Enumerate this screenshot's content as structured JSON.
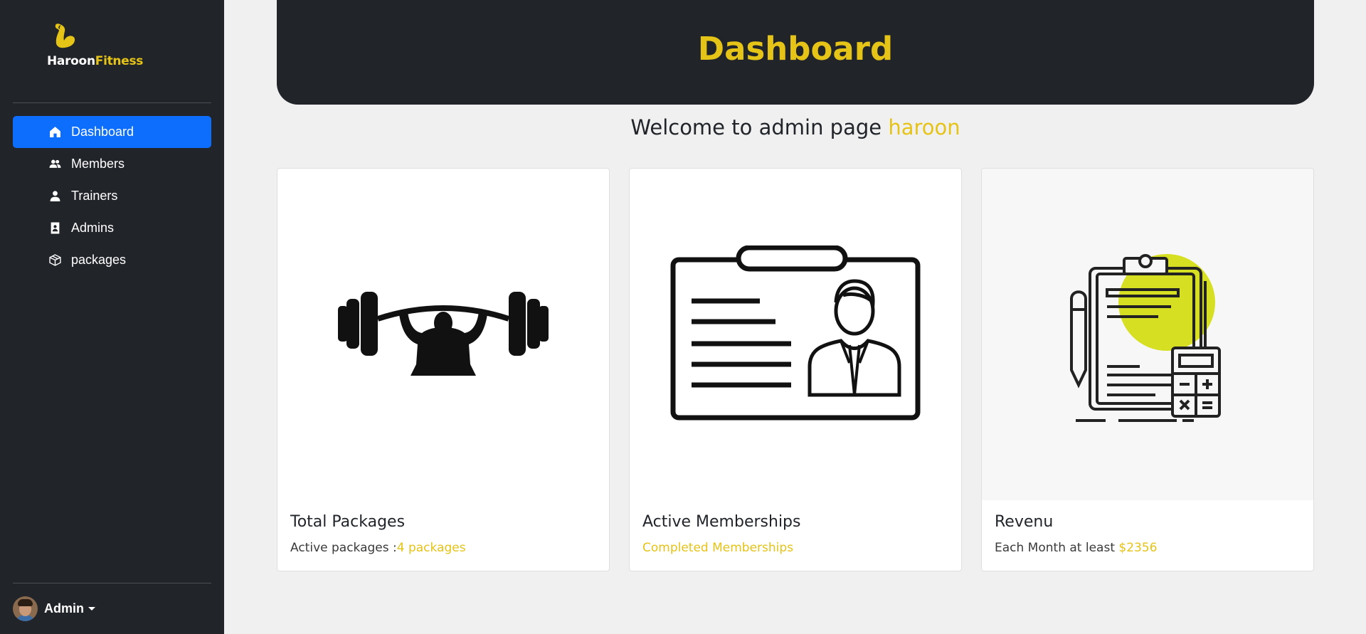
{
  "brand": {
    "name_part1": "Haroon",
    "name_part2": "Fitness",
    "accent_color": "#e5c317",
    "icon": "flexed-arm-icon"
  },
  "sidebar": {
    "items": [
      {
        "label": "Dashboard",
        "icon": "home-icon",
        "active": true
      },
      {
        "label": "Members",
        "icon": "users-icon",
        "active": false
      },
      {
        "label": "Trainers",
        "icon": "person-icon",
        "active": false
      },
      {
        "label": "Admins",
        "icon": "id-badge-icon",
        "active": false
      },
      {
        "label": "packages",
        "icon": "box-icon",
        "active": false
      }
    ],
    "user": {
      "name": "Admin",
      "icon": "avatar"
    }
  },
  "header": {
    "title": "Dashboard"
  },
  "welcome": {
    "text": "Welcome to admin page",
    "username": "haroon"
  },
  "cards": [
    {
      "title": "Total Packages",
      "text": "Active packages :",
      "highlight": "4 packages",
      "icon": "weightlifter-icon"
    },
    {
      "title": "Active Memberships",
      "text": "",
      "highlight": "Completed Memberships",
      "icon": "id-card-icon"
    },
    {
      "title": "Revenu",
      "text": "Each Month at least ",
      "highlight": "$2356",
      "icon": "clipboard-calculator-icon"
    }
  ],
  "colors": {
    "sidebar_bg": "#212529",
    "active_nav": "#0d6efd",
    "accent": "#e5c317",
    "page_bg": "#f0f0f0"
  }
}
